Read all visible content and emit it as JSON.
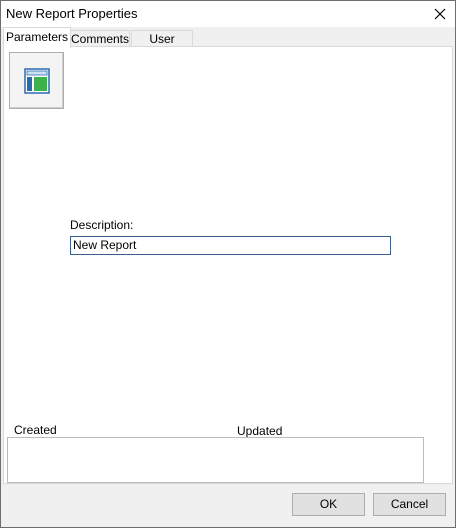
{
  "window": {
    "title": "New Report Properties"
  },
  "tabs": [
    {
      "label": "Parameters",
      "active": true
    },
    {
      "label": "Comments",
      "active": false
    },
    {
      "label": "User Fields",
      "active": false
    }
  ],
  "parameters": {
    "icon": "report-layout-icon",
    "description_label": "Description:",
    "description_value": "New Report",
    "created_label": "Created",
    "updated_label": "Updated"
  },
  "buttons": {
    "ok_label": "OK",
    "cancel_label": "Cancel"
  },
  "colors": {
    "icon_blue": "#2b6cb0",
    "icon_green": "#3cb34a",
    "input_border": "#3c5e8a"
  }
}
